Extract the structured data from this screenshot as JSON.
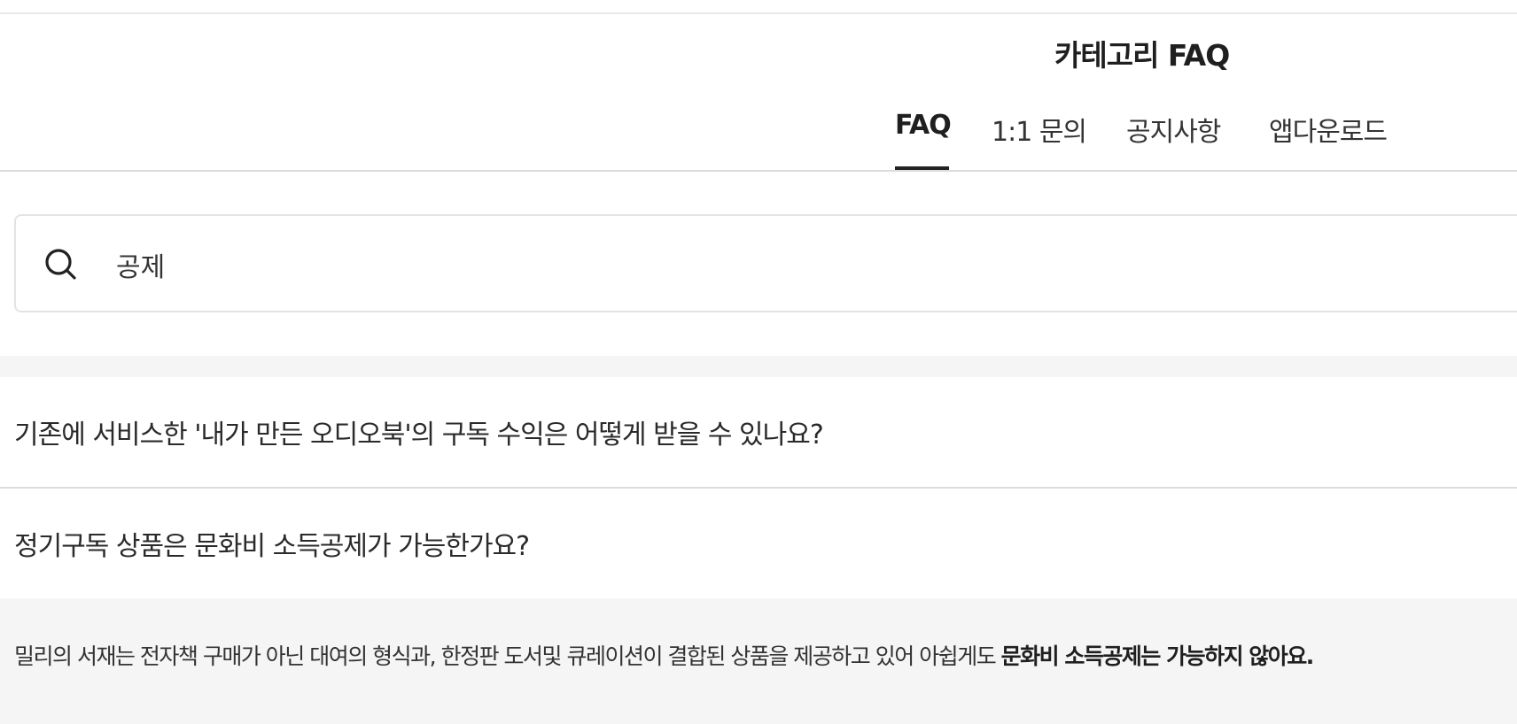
{
  "header": {
    "title": "카테고리 FAQ"
  },
  "tabs": [
    {
      "label": "FAQ",
      "active": true
    },
    {
      "label": "1:1 문의",
      "active": false
    },
    {
      "label": "공지사항",
      "active": false
    },
    {
      "label": "앱다운로드",
      "active": false
    }
  ],
  "search": {
    "value": "공제",
    "icon": "search-icon"
  },
  "faq": {
    "items": [
      {
        "question": "기존에 서비스한 '내가 만든 오디오북'의 구독 수익은 어떻게 받을 수 있나요?",
        "expanded": false
      },
      {
        "question": "정기구독 상품은 문화비 소득공제가 가능한가요?",
        "expanded": true
      }
    ],
    "answer": {
      "text": "밀리의 서재는 전자책 구매가 아닌 대여의 형식과, 한정판 도서및 큐레이션이 결합된 상품을 제공하고 있어 아쉽게도 ",
      "emphasis": "문화비 소득공제는 가능하지 않아요."
    }
  },
  "colors": {
    "text": "#222222",
    "divider": "#dcdcdc",
    "answer_bg": "#f5f5f5",
    "active_underline": "#222222"
  }
}
